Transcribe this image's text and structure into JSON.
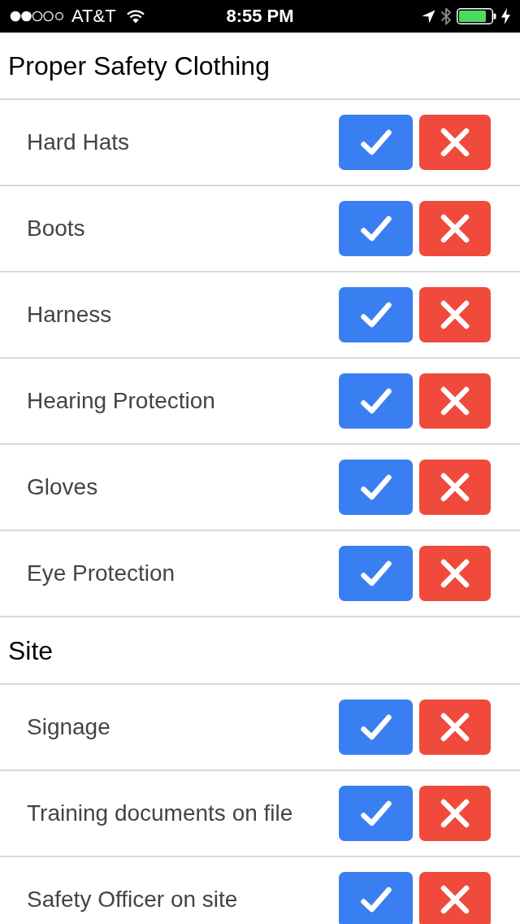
{
  "status_bar": {
    "carrier": "AT&T",
    "time": "8:55 PM"
  },
  "sections": [
    {
      "title": "Proper Safety Clothing",
      "items": [
        {
          "label": "Hard Hats"
        },
        {
          "label": "Boots"
        },
        {
          "label": "Harness"
        },
        {
          "label": "Hearing Protection"
        },
        {
          "label": "Gloves"
        },
        {
          "label": "Eye Protection"
        }
      ]
    },
    {
      "title": "Site",
      "items": [
        {
          "label": "Signage"
        },
        {
          "label": "Training documents on file"
        },
        {
          "label": "Safety Officer on site"
        }
      ]
    }
  ]
}
